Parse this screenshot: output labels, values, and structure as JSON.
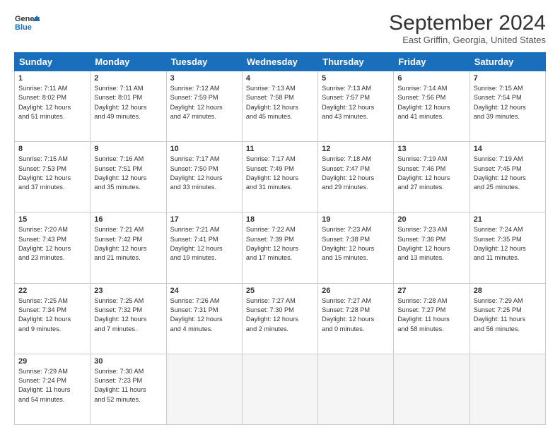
{
  "logo": {
    "line1": "General",
    "line2": "Blue"
  },
  "title": "September 2024",
  "subtitle": "East Griffin, Georgia, United States",
  "days_header": [
    "Sunday",
    "Monday",
    "Tuesday",
    "Wednesday",
    "Thursday",
    "Friday",
    "Saturday"
  ],
  "weeks": [
    [
      {
        "num": "1",
        "info": "Sunrise: 7:11 AM\nSunset: 8:02 PM\nDaylight: 12 hours\nand 51 minutes."
      },
      {
        "num": "2",
        "info": "Sunrise: 7:11 AM\nSunset: 8:01 PM\nDaylight: 12 hours\nand 49 minutes."
      },
      {
        "num": "3",
        "info": "Sunrise: 7:12 AM\nSunset: 7:59 PM\nDaylight: 12 hours\nand 47 minutes."
      },
      {
        "num": "4",
        "info": "Sunrise: 7:13 AM\nSunset: 7:58 PM\nDaylight: 12 hours\nand 45 minutes."
      },
      {
        "num": "5",
        "info": "Sunrise: 7:13 AM\nSunset: 7:57 PM\nDaylight: 12 hours\nand 43 minutes."
      },
      {
        "num": "6",
        "info": "Sunrise: 7:14 AM\nSunset: 7:56 PM\nDaylight: 12 hours\nand 41 minutes."
      },
      {
        "num": "7",
        "info": "Sunrise: 7:15 AM\nSunset: 7:54 PM\nDaylight: 12 hours\nand 39 minutes."
      }
    ],
    [
      {
        "num": "8",
        "info": "Sunrise: 7:15 AM\nSunset: 7:53 PM\nDaylight: 12 hours\nand 37 minutes."
      },
      {
        "num": "9",
        "info": "Sunrise: 7:16 AM\nSunset: 7:51 PM\nDaylight: 12 hours\nand 35 minutes."
      },
      {
        "num": "10",
        "info": "Sunrise: 7:17 AM\nSunset: 7:50 PM\nDaylight: 12 hours\nand 33 minutes."
      },
      {
        "num": "11",
        "info": "Sunrise: 7:17 AM\nSunset: 7:49 PM\nDaylight: 12 hours\nand 31 minutes."
      },
      {
        "num": "12",
        "info": "Sunrise: 7:18 AM\nSunset: 7:47 PM\nDaylight: 12 hours\nand 29 minutes."
      },
      {
        "num": "13",
        "info": "Sunrise: 7:19 AM\nSunset: 7:46 PM\nDaylight: 12 hours\nand 27 minutes."
      },
      {
        "num": "14",
        "info": "Sunrise: 7:19 AM\nSunset: 7:45 PM\nDaylight: 12 hours\nand 25 minutes."
      }
    ],
    [
      {
        "num": "15",
        "info": "Sunrise: 7:20 AM\nSunset: 7:43 PM\nDaylight: 12 hours\nand 23 minutes."
      },
      {
        "num": "16",
        "info": "Sunrise: 7:21 AM\nSunset: 7:42 PM\nDaylight: 12 hours\nand 21 minutes."
      },
      {
        "num": "17",
        "info": "Sunrise: 7:21 AM\nSunset: 7:41 PM\nDaylight: 12 hours\nand 19 minutes."
      },
      {
        "num": "18",
        "info": "Sunrise: 7:22 AM\nSunset: 7:39 PM\nDaylight: 12 hours\nand 17 minutes."
      },
      {
        "num": "19",
        "info": "Sunrise: 7:23 AM\nSunset: 7:38 PM\nDaylight: 12 hours\nand 15 minutes."
      },
      {
        "num": "20",
        "info": "Sunrise: 7:23 AM\nSunset: 7:36 PM\nDaylight: 12 hours\nand 13 minutes."
      },
      {
        "num": "21",
        "info": "Sunrise: 7:24 AM\nSunset: 7:35 PM\nDaylight: 12 hours\nand 11 minutes."
      }
    ],
    [
      {
        "num": "22",
        "info": "Sunrise: 7:25 AM\nSunset: 7:34 PM\nDaylight: 12 hours\nand 9 minutes."
      },
      {
        "num": "23",
        "info": "Sunrise: 7:25 AM\nSunset: 7:32 PM\nDaylight: 12 hours\nand 7 minutes."
      },
      {
        "num": "24",
        "info": "Sunrise: 7:26 AM\nSunset: 7:31 PM\nDaylight: 12 hours\nand 4 minutes."
      },
      {
        "num": "25",
        "info": "Sunrise: 7:27 AM\nSunset: 7:30 PM\nDaylight: 12 hours\nand 2 minutes."
      },
      {
        "num": "26",
        "info": "Sunrise: 7:27 AM\nSunset: 7:28 PM\nDaylight: 12 hours\nand 0 minutes."
      },
      {
        "num": "27",
        "info": "Sunrise: 7:28 AM\nSunset: 7:27 PM\nDaylight: 11 hours\nand 58 minutes."
      },
      {
        "num": "28",
        "info": "Sunrise: 7:29 AM\nSunset: 7:25 PM\nDaylight: 11 hours\nand 56 minutes."
      }
    ],
    [
      {
        "num": "29",
        "info": "Sunrise: 7:29 AM\nSunset: 7:24 PM\nDaylight: 11 hours\nand 54 minutes."
      },
      {
        "num": "30",
        "info": "Sunrise: 7:30 AM\nSunset: 7:23 PM\nDaylight: 11 hours\nand 52 minutes."
      },
      null,
      null,
      null,
      null,
      null
    ]
  ]
}
